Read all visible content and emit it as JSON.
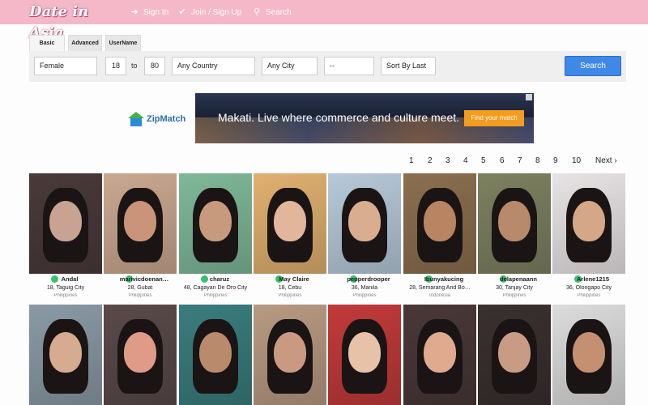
{
  "header": {
    "logo_text": "Date in Asia",
    "nav": [
      {
        "label": "Sign In",
        "icon": "sign-in-icon"
      },
      {
        "label": "Join / Sign Up",
        "icon": "checkmark-icon"
      },
      {
        "label": "Search",
        "icon": "search-icon"
      }
    ],
    "colors": {
      "bar": "#f4b8c9"
    }
  },
  "search": {
    "tabs": [
      {
        "label": "Basic",
        "active": true
      },
      {
        "label": "Advanced",
        "active": false
      },
      {
        "label": "UserName",
        "active": false
      }
    ],
    "gender": "Female",
    "age_min": "18",
    "age_to_label": "to",
    "age_max": "80",
    "country": "Any Country",
    "city": "Any City",
    "extra": "--",
    "sort": "Sort By Last",
    "button_label": "Search",
    "button_color": "#3f88e8"
  },
  "ad": {
    "brand": "ZipMatch",
    "headline": "Makati. Live where commerce and culture meet.",
    "cta": "Find your match"
  },
  "pagination": {
    "pages": [
      "1",
      "2",
      "3",
      "4",
      "5",
      "6",
      "7",
      "8",
      "9",
      "10"
    ],
    "next_label": "Next"
  },
  "profiles": [
    {
      "name": "Andal",
      "info": "18, Taguig City",
      "country": "Philippines",
      "bg": "#4a3a3a",
      "skin": "#c9a392"
    },
    {
      "name": "marivicdoenan…",
      "info": "28, Gubat",
      "country": "Philippines",
      "bg": "#caa890",
      "skin": "#c99479"
    },
    {
      "name": "charuz",
      "info": "48, Cagayan De Oro City",
      "country": "Philippines",
      "bg": "#7fb899",
      "skin": "#c79a7e"
    },
    {
      "name": "May Claire",
      "info": "18, Cebu",
      "country": "Philippines",
      "bg": "#e0b070",
      "skin": "#e2b69a"
    },
    {
      "name": "pepperdrooper",
      "info": "36, Manila",
      "country": "Philippines",
      "bg": "#b7c9d9",
      "skin": "#d9ad8f"
    },
    {
      "name": "Ibunyakucing",
      "info": "28, Semarang And Bo…",
      "country": "Indonesia",
      "bg": "#8b6f4f",
      "skin": "#b98462"
    },
    {
      "name": "delapenaann",
      "info": "30, Tanjay City",
      "country": "Philippines",
      "bg": "#7d8160",
      "skin": "#b88a6b"
    },
    {
      "name": "Arlene1215",
      "info": "36, Olongapo City",
      "country": "Philippines",
      "bg": "#e8e4e6",
      "skin": "#d4a789"
    },
    {
      "name": "",
      "info": "",
      "country": "",
      "bg": "#8a9aa5",
      "skin": "#d7ab90"
    },
    {
      "name": "",
      "info": "",
      "country": "",
      "bg": "#5a4a4a",
      "skin": "#e09a88"
    },
    {
      "name": "",
      "info": "",
      "country": "",
      "bg": "#3a7d7d",
      "skin": "#b98a6c"
    },
    {
      "name": "",
      "info": "",
      "country": "",
      "bg": "#b89a82",
      "skin": "#c99a80"
    },
    {
      "name": "",
      "info": "",
      "country": "",
      "bg": "#c23a3a",
      "skin": "#e8c2a8"
    },
    {
      "name": "",
      "info": "",
      "country": "",
      "bg": "#4a3838",
      "skin": "#e0aa8e"
    },
    {
      "name": "",
      "info": "",
      "country": "",
      "bg": "#3a3030",
      "skin": "#c99b84"
    },
    {
      "name": "",
      "info": "",
      "country": "",
      "bg": "#dcdcdc",
      "skin": "#c58f72"
    }
  ]
}
